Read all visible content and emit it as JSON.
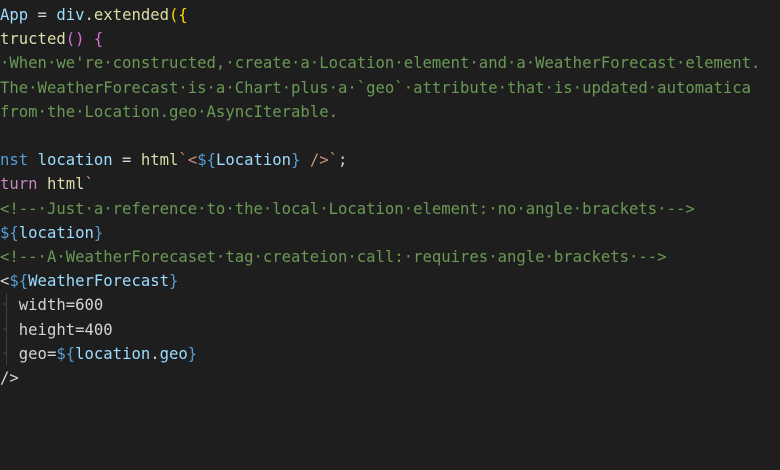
{
  "editor": {
    "lines": [
      {
        "segments": [
          {
            "t": "App",
            "c": "tok-ident"
          },
          {
            "t": " = ",
            "c": "tok-plain"
          },
          {
            "t": "div",
            "c": "tok-ident"
          },
          {
            "t": ".",
            "c": "tok-plain"
          },
          {
            "t": "extended",
            "c": "tok-func"
          },
          {
            "t": "({",
            "c": "tok-bracket"
          }
        ]
      },
      {
        "segments": [
          {
            "t": "tructed",
            "c": "tok-func"
          },
          {
            "t": "()",
            "c": "tok-brace2"
          },
          {
            "t": " ",
            "c": "tok-plain"
          },
          {
            "t": "{",
            "c": "tok-brace2"
          }
        ]
      },
      {
        "segments": [
          {
            "t": "·When·we're·constructed,·create·a·Location·element·and·a·WeatherForecast·element.",
            "c": "tok-comment"
          }
        ]
      },
      {
        "segments": [
          {
            "t": "The·WeatherForecast·is·a·Chart·plus·a·`geo`·attribute·that·is·updated·automatica",
            "c": "tok-comment"
          }
        ]
      },
      {
        "segments": [
          {
            "t": "from·the·Location.geo·AsyncIterable.",
            "c": "tok-comment"
          }
        ]
      },
      {
        "segments": []
      },
      {
        "segments": [
          {
            "t": "nst",
            "c": "tok-storage"
          },
          {
            "t": " ",
            "c": "tok-plain"
          },
          {
            "t": "location",
            "c": "tok-ident"
          },
          {
            "t": " = ",
            "c": "tok-plain"
          },
          {
            "t": "html",
            "c": "tok-func"
          },
          {
            "t": "`<",
            "c": "tok-string"
          },
          {
            "t": "${",
            "c": "tok-tmpl"
          },
          {
            "t": "Location",
            "c": "tok-interp"
          },
          {
            "t": "}",
            "c": "tok-tmpl"
          },
          {
            "t": " />`",
            "c": "tok-string"
          },
          {
            "t": ";",
            "c": "tok-plain"
          }
        ]
      },
      {
        "segments": [
          {
            "t": "turn",
            "c": "tok-keyword"
          },
          {
            "t": " ",
            "c": "tok-plain"
          },
          {
            "t": "html",
            "c": "tok-func"
          },
          {
            "t": "`",
            "c": "tok-string"
          }
        ]
      },
      {
        "segments": [
          {
            "t": "<!--·Just·a·reference·to·the·local·Location·element:·no·angle·brackets·-->",
            "c": "tok-comment"
          }
        ]
      },
      {
        "segments": [
          {
            "t": "${",
            "c": "tok-tmpl"
          },
          {
            "t": "location",
            "c": "tok-interp"
          },
          {
            "t": "}",
            "c": "tok-tmpl"
          }
        ]
      },
      {
        "segments": [
          {
            "t": "<!--·A·WeatherForecaset·tag·createion·call:·requires·angle·brackets·-->",
            "c": "tok-comment"
          }
        ]
      },
      {
        "segments": [
          {
            "t": "<",
            "c": "tok-plain"
          },
          {
            "t": "${",
            "c": "tok-tmpl"
          },
          {
            "t": "WeatherForecast",
            "c": "tok-interp"
          },
          {
            "t": "}",
            "c": "tok-tmpl"
          }
        ]
      },
      {
        "segments": [
          {
            "t": "· ",
            "c": "ws"
          },
          {
            "t": "width=600",
            "c": "tok-plain"
          }
        ]
      },
      {
        "segments": [
          {
            "t": "· ",
            "c": "ws"
          },
          {
            "t": "height=400",
            "c": "tok-plain"
          }
        ]
      },
      {
        "segments": [
          {
            "t": "· ",
            "c": "ws"
          },
          {
            "t": "geo=",
            "c": "tok-plain"
          },
          {
            "t": "${",
            "c": "tok-tmpl"
          },
          {
            "t": "location",
            "c": "tok-interp"
          },
          {
            "t": ".",
            "c": "tok-plain"
          },
          {
            "t": "geo",
            "c": "tok-interp"
          },
          {
            "t": "}",
            "c": "tok-tmpl"
          }
        ]
      },
      {
        "segments": [
          {
            "t": "/>",
            "c": "tok-plain"
          }
        ]
      }
    ]
  },
  "colors": {
    "background": "#1e1e1e",
    "comment": "#6a9955",
    "identifier": "#9cdcfe",
    "function": "#dcdcaa",
    "keyword": "#c586c0",
    "storage": "#569cd6"
  }
}
